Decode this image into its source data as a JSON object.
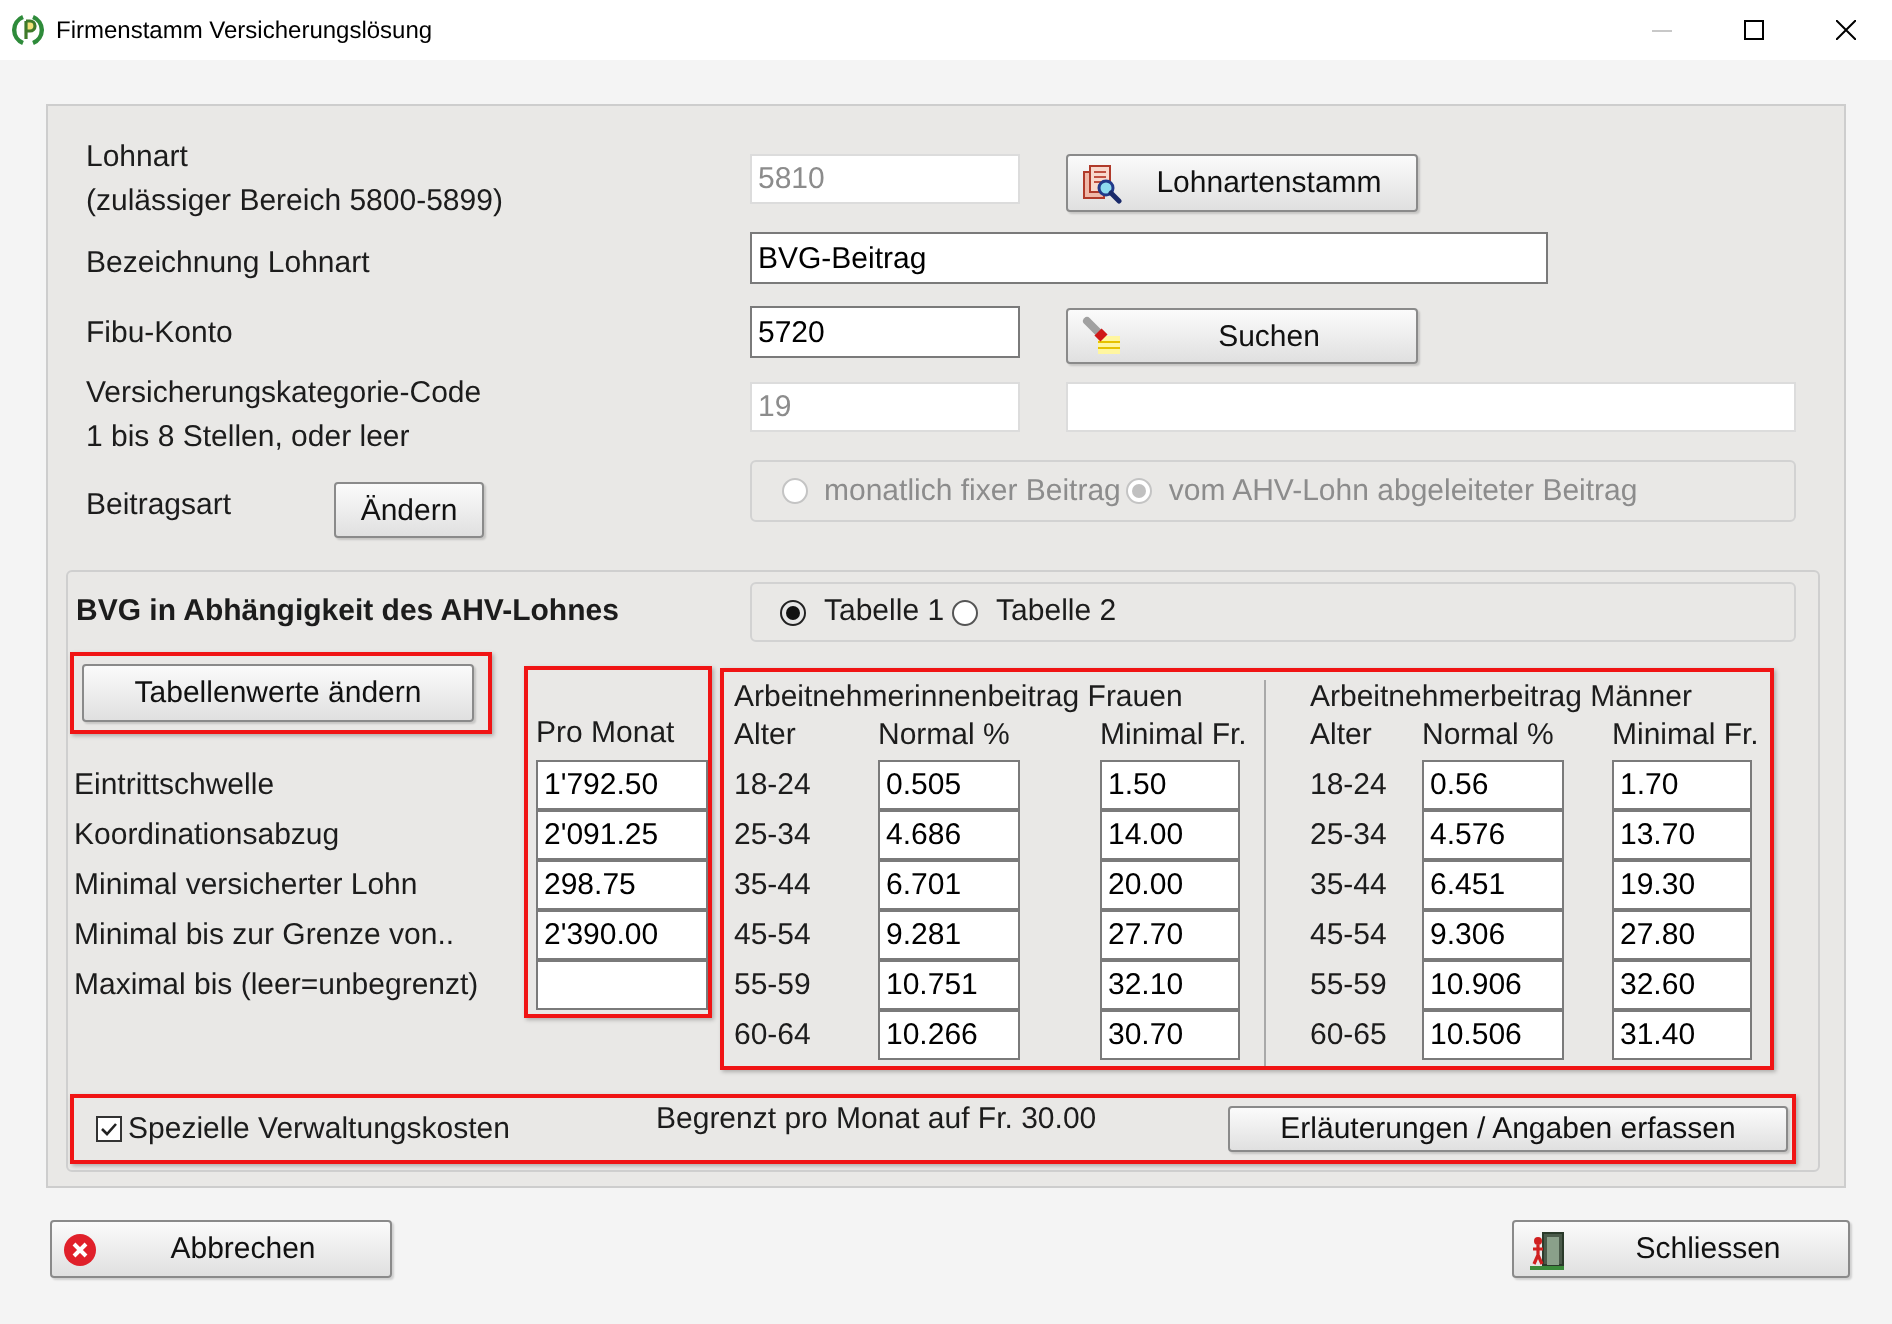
{
  "window": {
    "title": "Firmenstamm Versicherungslösung",
    "minimize_disabled": true
  },
  "wage_type": {
    "label": "Lohnart",
    "hint": "(zulässiger Bereich 5800-5899)",
    "value": "5810",
    "disabled": true,
    "button": {
      "kind": "lookup",
      "label": "Lohnartenstamm"
    }
  },
  "designation": {
    "label": "Bezeichnung Lohnart",
    "value": "BVG-Beitrag"
  },
  "account": {
    "label": "Fibu-Konto",
    "value": "5720",
    "button": {
      "kind": "search",
      "label": "Suchen"
    }
  },
  "insurance_category": {
    "label": "Versicherungskategorie-Code",
    "hint": "1 bis 8 Stellen, oder leer",
    "value": "19",
    "disabled": true,
    "description": {
      "disabled": true
    }
  },
  "contribution_type": {
    "label": "Beitragsart",
    "button": "Ändern",
    "disabled": true,
    "options": [
      {
        "label": "monatlich fixer Beitrag",
        "selected": false
      },
      {
        "label": "vom AHV-Lohn abgeleiteter Beitrag",
        "selected": true
      }
    ]
  },
  "bvg_section": {
    "title": "BVG in Abhängigkeit des AHV-Lohnes",
    "tables": [
      {
        "label": "Tabelle 1",
        "selected": true
      },
      {
        "label": "Tabelle 2",
        "selected": false
      }
    ],
    "edit_area": {
      "highlighted": true,
      "button": "Tabellenwerte ändern"
    },
    "limits": {
      "highlighted": true,
      "header": "Pro Monat",
      "rows": [
        {
          "label": "Eintrittschwelle",
          "value": "1'792.50"
        },
        {
          "label": "Koordinationsabzug",
          "value": "2'091.25"
        },
        {
          "label": "Minimal versicherter Lohn",
          "value": "298.75"
        },
        {
          "label": "Minimal bis zur Grenze von..",
          "value": "2'390.00"
        },
        {
          "label": "Maximal bis (leer=unbegrenzt)"
        }
      ]
    },
    "rates": {
      "highlighted": true,
      "groups": [
        {
          "title": "Arbeitnehmerinnenbeitrag Frauen",
          "columns": [
            "Alter",
            "Normal %",
            "Minimal Fr."
          ],
          "rows": [
            {
              "age": "18-24",
              "normal": "0.505",
              "minimum": "1.50"
            },
            {
              "age": "25-34",
              "normal": "4.686",
              "minimum": "14.00"
            },
            {
              "age": "35-44",
              "normal": "6.701",
              "minimum": "20.00"
            },
            {
              "age": "45-54",
              "normal": "9.281",
              "minimum": "27.70"
            },
            {
              "age": "55-59",
              "normal": "10.751",
              "minimum": "32.10"
            },
            {
              "age": "60-64",
              "normal": "10.266",
              "minimum": "30.70"
            }
          ]
        },
        {
          "title": "Arbeitnehmerbeitrag Männer",
          "columns": [
            "Alter",
            "Normal %",
            "Minimal Fr."
          ],
          "rows": [
            {
              "age": "18-24",
              "normal": "0.56",
              "minimum": "1.70"
            },
            {
              "age": "25-34",
              "normal": "4.576",
              "minimum": "13.70"
            },
            {
              "age": "35-44",
              "normal": "6.451",
              "minimum": "19.30"
            },
            {
              "age": "45-54",
              "normal": "9.306",
              "minimum": "27.80"
            },
            {
              "age": "55-59",
              "normal": "10.906",
              "minimum": "32.60"
            },
            {
              "age": "60-65",
              "normal": "10.506",
              "minimum": "31.40"
            }
          ]
        }
      ]
    },
    "admin_costs": {
      "highlighted": true,
      "checkbox": {
        "label": "Spezielle Verwaltungskosten",
        "checked": true
      },
      "note": "Begrenzt pro Monat auf Fr. 30.00",
      "button": "Erläuterungen / Angaben erfassen"
    }
  },
  "buttons": [
    {
      "kind": "cancel",
      "label": "Abbrechen"
    },
    {
      "kind": "close",
      "label": "Schliessen"
    }
  ]
}
